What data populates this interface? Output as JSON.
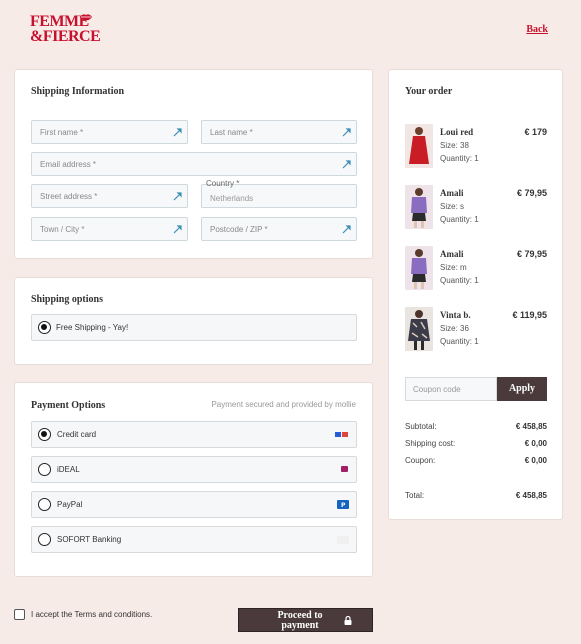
{
  "brand": {
    "logo_line1": "FEMME",
    "logo_line2": "&FIERCE",
    "accent_color": "#c8102e"
  },
  "header": {
    "back_label": "Back"
  },
  "shipping_info": {
    "title": "Shipping Information",
    "first_name": "First name *",
    "last_name": "Last name *",
    "email": "Email address *",
    "street": "Street address *",
    "country_label": "Country *",
    "country_value": "Netherlands",
    "town": "Town / City *",
    "postcode": "Postcode / ZIP *"
  },
  "shipping_options": {
    "title": "Shipping options",
    "options": [
      {
        "label": "Free Shipping - Yay!",
        "selected": true
      }
    ]
  },
  "payment": {
    "title": "Payment Options",
    "secured_text": "Payment secured and provided by mollie",
    "methods": [
      {
        "label": "Credit card",
        "selected": true,
        "icon": "credit-card-icon"
      },
      {
        "label": "iDEAL",
        "selected": false,
        "icon": "ideal-icon"
      },
      {
        "label": "PayPal",
        "selected": false,
        "icon": "paypal-icon"
      },
      {
        "label": "SOFORT Banking",
        "selected": false,
        "icon": "sofort-icon"
      }
    ]
  },
  "order": {
    "title": "Your order",
    "items": [
      {
        "name": "Loui red",
        "price": "€ 179",
        "size": "Size:  38",
        "quantity": "Quantity: 1",
        "color": "#c81d25"
      },
      {
        "name": "Amali",
        "price": "€ 79,95",
        "size": "Size:  s",
        "quantity": "Quantity: 1",
        "color": "#8a6cc0"
      },
      {
        "name": "Amali",
        "price": "€ 79,95",
        "size": "Size:  m",
        "quantity": "Quantity: 1",
        "color": "#8a6cc0"
      },
      {
        "name": "Vinta b.",
        "price": "€ 119,95",
        "size": "Size:  36",
        "quantity": "Quantity: 1",
        "color": "#3b3b4a"
      }
    ],
    "coupon_placeholder": "Coupon code",
    "apply_label": "Apply",
    "subtotal_label": "Subtotal:",
    "subtotal_value": "€ 458,85",
    "shipping_label": "Shipping cost:",
    "shipping_value": "€ 0,00",
    "coupon_label": "Coupon:",
    "coupon_value": "€ 0,00",
    "total_label": "Total:",
    "total_value": "€ 458,85"
  },
  "footer": {
    "terms_text": "I accept the Terms and conditions.",
    "proceed_label": "Proceed to payment"
  }
}
